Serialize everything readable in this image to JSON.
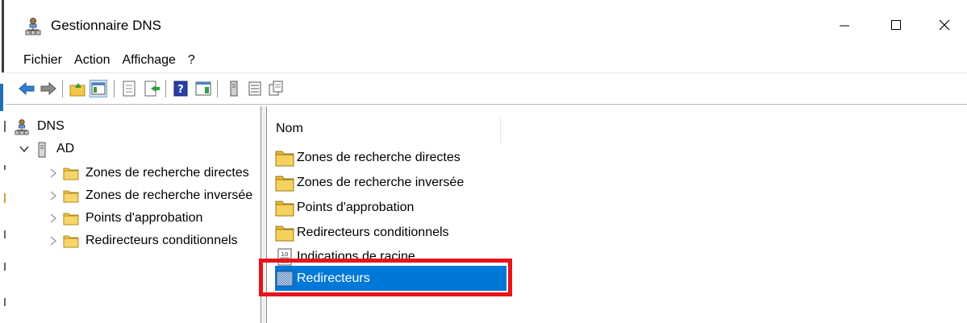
{
  "window": {
    "title": "Gestionnaire DNS",
    "controls": [
      "minimize-icon",
      "maximize-icon",
      "close-icon"
    ]
  },
  "menu": {
    "items": [
      "Fichier",
      "Action",
      "Affichage",
      "?"
    ]
  },
  "toolbar": {
    "icons": [
      "back-arrow-icon",
      "forward-arrow-icon",
      "up-folder-icon",
      "show-hide-tree-icon",
      "properties-icon",
      "export-list-icon",
      "help-icon",
      "console-pane-icon",
      "server-icon",
      "list-icon",
      "copy-icon"
    ]
  },
  "tree": {
    "root": "DNS",
    "server": "AD",
    "children": [
      "Zones de recherche directes",
      "Zones de recherche inversée",
      "Points d'approbation",
      "Redirecteurs conditionnels"
    ]
  },
  "list": {
    "column_header": "Nom",
    "items": [
      {
        "label": "Zones de recherche directes",
        "icon": "folder-icon"
      },
      {
        "label": "Zones de recherche inversée",
        "icon": "folder-icon"
      },
      {
        "label": "Points d'approbation",
        "icon": "folder-icon"
      },
      {
        "label": "Redirecteurs conditionnels",
        "icon": "folder-icon"
      },
      {
        "label": "Indications de racine",
        "icon": "root-hints-icon"
      },
      {
        "label": "Redirecteurs",
        "icon": "forwarders-icon",
        "selected": true
      }
    ]
  },
  "colors": {
    "selection": "#0078d7",
    "highlight_border": "#e8141c",
    "folder": "#f3c84a"
  }
}
